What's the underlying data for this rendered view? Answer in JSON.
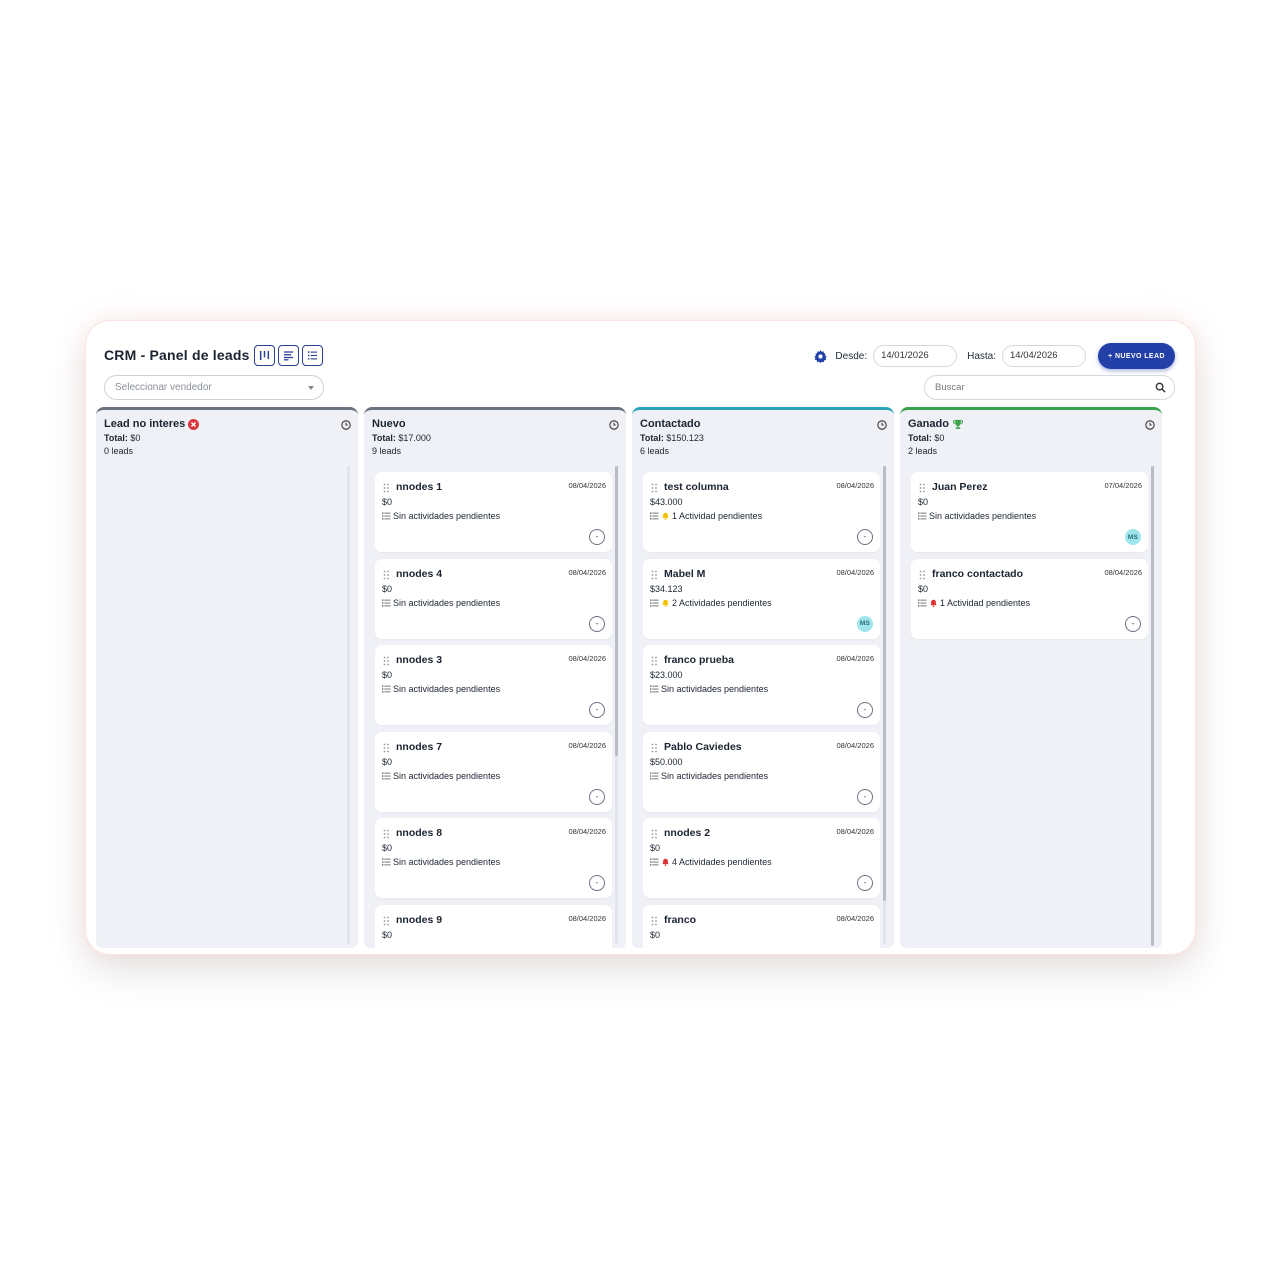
{
  "header": {
    "title": "CRM - Panel de leads",
    "view_buttons": [
      "kanban-view-icon",
      "sort-lines-icon",
      "list-view-icon"
    ],
    "settings_icon": "gear-icon",
    "desde_label": "Desde:",
    "desde_value": "14/01/2026",
    "hasta_label": "Hasta:",
    "hasta_value": "14/04/2026",
    "new_lead_label": "+ NUEVO LEAD"
  },
  "filters": {
    "vendor_placeholder": "Seleccionar vendedor",
    "search_placeholder": "Buscar"
  },
  "colors": {
    "accent": "#2240a8",
    "column_lead_no_interes": "#6b7280",
    "column_nuevo": "#6b7280",
    "column_contactado": "#2aa3b8",
    "column_ganado": "#3aa24a",
    "bell_yellow": "#f2c200",
    "bell_red": "#e03131"
  },
  "columns": [
    {
      "title": "Lead no interes",
      "icon": "x-circle-icon",
      "total_label": "Total:",
      "total_value": "$0",
      "count": "0 leads",
      "cards": []
    },
    {
      "title": "Nuevo",
      "icon": "",
      "total_label": "Total:",
      "total_value": "$17.000",
      "count": "9 leads",
      "cards": [
        {
          "name": "nnodes 1",
          "date": "08/04/2026",
          "amount": "$0",
          "activity": "Sin actividades pendientes",
          "bell": "",
          "avatar": ""
        },
        {
          "name": "nnodes 4",
          "date": "08/04/2026",
          "amount": "$0",
          "activity": "Sin actividades pendientes",
          "bell": "",
          "avatar": ""
        },
        {
          "name": "nnodes 3",
          "date": "08/04/2026",
          "amount": "$0",
          "activity": "Sin actividades pendientes",
          "bell": "",
          "avatar": ""
        },
        {
          "name": "nnodes 7",
          "date": "08/04/2026",
          "amount": "$0",
          "activity": "Sin actividades pendientes",
          "bell": "",
          "avatar": ""
        },
        {
          "name": "nnodes 8",
          "date": "08/04/2026",
          "amount": "$0",
          "activity": "Sin actividades pendientes",
          "bell": "",
          "avatar": ""
        },
        {
          "name": "nnodes 9",
          "date": "08/04/2026",
          "amount": "$0",
          "activity": "",
          "bell": "",
          "avatar": ""
        }
      ]
    },
    {
      "title": "Contactado",
      "icon": "",
      "total_label": "Total:",
      "total_value": "$150.123",
      "count": "6 leads",
      "cards": [
        {
          "name": "test columna",
          "date": "08/04/2026",
          "amount": "$43.000",
          "activity": "1 Actividad pendientes",
          "bell": "yellow",
          "avatar": ""
        },
        {
          "name": "Mabel M",
          "date": "08/04/2026",
          "amount": "$34.123",
          "activity": "2 Actividades pendientes",
          "bell": "yellow",
          "avatar": "MS"
        },
        {
          "name": "franco prueba",
          "date": "08/04/2026",
          "amount": "$23.000",
          "activity": "Sin actividades pendientes",
          "bell": "",
          "avatar": ""
        },
        {
          "name": "Pablo Caviedes",
          "date": "08/04/2026",
          "amount": "$50.000",
          "activity": "Sin actividades pendientes",
          "bell": "",
          "avatar": ""
        },
        {
          "name": "nnodes 2",
          "date": "08/04/2026",
          "amount": "$0",
          "activity": "4 Actividades pendientes",
          "bell": "red",
          "avatar": ""
        },
        {
          "name": "franco",
          "date": "08/04/2026",
          "amount": "$0",
          "activity": "",
          "bell": "",
          "avatar": ""
        }
      ]
    },
    {
      "title": "Ganado",
      "icon": "trophy-icon",
      "total_label": "Total:",
      "total_value": "$0",
      "count": "2 leads",
      "cards": [
        {
          "name": "Juan Perez",
          "date": "07/04/2026",
          "amount": "$0",
          "activity": "Sin actividades pendientes",
          "bell": "",
          "avatar": "MS"
        },
        {
          "name": "franco contactado",
          "date": "08/04/2026",
          "amount": "$0",
          "activity": "1 Actividad pendientes",
          "bell": "red",
          "avatar": ""
        }
      ]
    }
  ]
}
